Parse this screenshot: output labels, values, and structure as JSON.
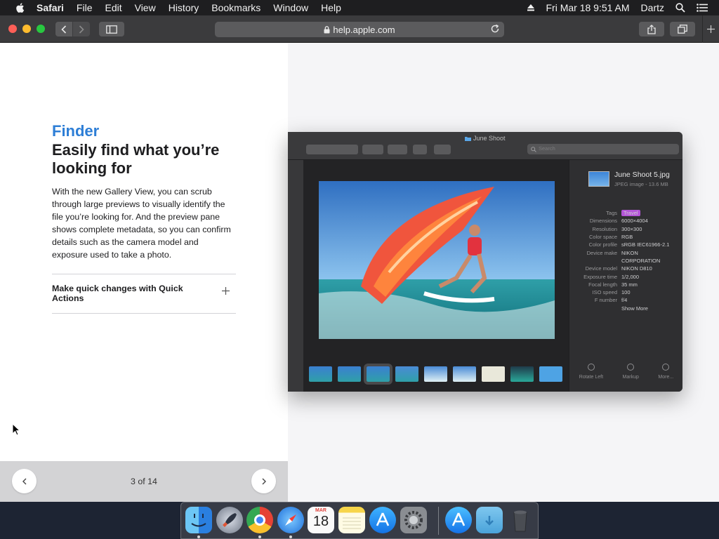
{
  "menubar": {
    "app_name": "Safari",
    "items": [
      "File",
      "Edit",
      "View",
      "History",
      "Bookmarks",
      "Window",
      "Help"
    ],
    "clock": "Fri Mar 18  9:51 AM",
    "user": "Dartz"
  },
  "browser": {
    "url": "help.apple.com"
  },
  "article": {
    "kicker": "Finder",
    "headline": "Easily find what you’re looking for",
    "body": "With the new Gallery View, you can scrub through large previews to visually identify the file you’re looking for. And the preview pane shows complete metadata, so you can confirm details such as the camera model and exposure used to take a photo.",
    "accordion_label": "Make quick changes with Quick Actions",
    "pager": "3 of 14"
  },
  "finder_mock": {
    "window_title": "June Shoot",
    "search_placeholder": "Search",
    "file_name": "June Shoot 5.jpg",
    "file_sub": "JPEG image - 13.6 MB",
    "metadata": [
      {
        "k": "Tags",
        "v": "Travel"
      },
      {
        "k": "Dimensions",
        "v": "6000×4004"
      },
      {
        "k": "Resolution",
        "v": "300×300"
      },
      {
        "k": "Color space",
        "v": "RGB"
      },
      {
        "k": "Color profile",
        "v": "sRGB IEC61966-2.1"
      },
      {
        "k": "Device make",
        "v": "NIKON"
      },
      {
        "k": "",
        "v": "CORPORATION"
      },
      {
        "k": "Device model",
        "v": "NIKON D810"
      },
      {
        "k": "Exposure time",
        "v": "1/2,000"
      },
      {
        "k": "Focal length",
        "v": "35 mm"
      },
      {
        "k": "ISO speed",
        "v": "100"
      },
      {
        "k": "F number",
        "v": "f/4"
      },
      {
        "k": "",
        "v": "Show More"
      }
    ],
    "actions": [
      "Rotate Left",
      "Markup",
      "More..."
    ]
  },
  "dock": {
    "apps": [
      "finder",
      "launchpad",
      "chrome",
      "safari",
      "calendar",
      "notes",
      "app-store",
      "system-preferences",
      "app-store-download",
      "downloads-folder",
      "trash"
    ],
    "calendar_month": "MAR",
    "calendar_day": "18"
  },
  "colors": {
    "accent_blue": "#2d7ed6",
    "tag_purple": "#b455d8"
  }
}
